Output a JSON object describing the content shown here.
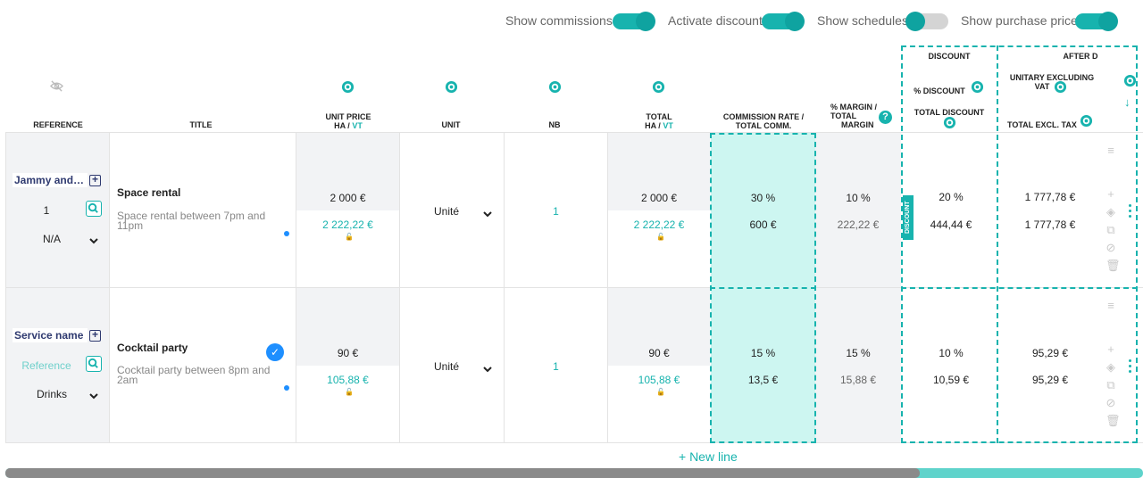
{
  "toggles": [
    {
      "label": "Show commissions",
      "on": true
    },
    {
      "label": "Activate discount",
      "on": true
    },
    {
      "label": "Show schedules",
      "on": false
    },
    {
      "label": "Show purchase price",
      "on": true
    }
  ],
  "headers": {
    "reference": "REFERENCE",
    "title": "TITLE",
    "unit_price_line1": "UNIT PRICE",
    "unit_price_ha": "HA /",
    "unit_price_vt": "VT",
    "unit": "UNIT",
    "nb": "NB",
    "total_line1": "TOTAL",
    "total_ha": "HA /",
    "total_vt": "VT",
    "commission_line1": "COMMISSION RATE /",
    "commission_line2": "TOTAL COMM.",
    "margin_line1": "% MARGIN / TOTAL",
    "margin_line2": "MARGIN",
    "discount_group": "DISCOUNT",
    "discount_pct": "% DISCOUNT",
    "discount_total": "TOTAL DISCOUNT",
    "after_group": "AFTER D",
    "unitary_line1": "UNITARY EXCLUDING",
    "unitary_line2": "VAT",
    "total_excl": "TOTAL EXCL. TAX"
  },
  "rows": [
    {
      "ref_name": "Jammy and c...",
      "ref_code": "1",
      "ref_category": "N/A",
      "title": "Space rental",
      "description": "Space rental between 7pm and 11pm",
      "checked": false,
      "unit_price_ha": "2 000 €",
      "unit_price_vt": "2 222,22 €",
      "unit": "Unité",
      "nb": "1",
      "total_ha": "2 000 €",
      "total_vt": "2 222,22 €",
      "commission_rate": "30 %",
      "commission_total": "600 €",
      "margin_pct": "10 %",
      "margin_total": "222,22 €",
      "discount_pct": "20 %",
      "discount_total": "444,44 €",
      "unitary_excl": "1 777,78 €",
      "total_excl": "1 777,78 €",
      "discount_tag": "DISCOUNT"
    },
    {
      "ref_name": "Service name",
      "ref_code": "Reference",
      "ref_category": "Drinks",
      "title": "Cocktail party",
      "description": "Cocktail party between 8pm and 2am",
      "checked": true,
      "unit_price_ha": "90 €",
      "unit_price_vt": "105,88 €",
      "unit": "Unité",
      "nb": "1",
      "total_ha": "90 €",
      "total_vt": "105,88 €",
      "commission_rate": "15 %",
      "commission_total": "13,5 €",
      "margin_pct": "15 %",
      "margin_total": "15,88 €",
      "discount_pct": "10 %",
      "discount_total": "10,59 €",
      "unitary_excl": "95,29 €",
      "total_excl": "95,29 €"
    }
  ],
  "new_line": "+ New line",
  "colors": {
    "accent": "#17b3ae",
    "navy": "#2f3a70",
    "commission_fill": "#cdf6f1"
  }
}
